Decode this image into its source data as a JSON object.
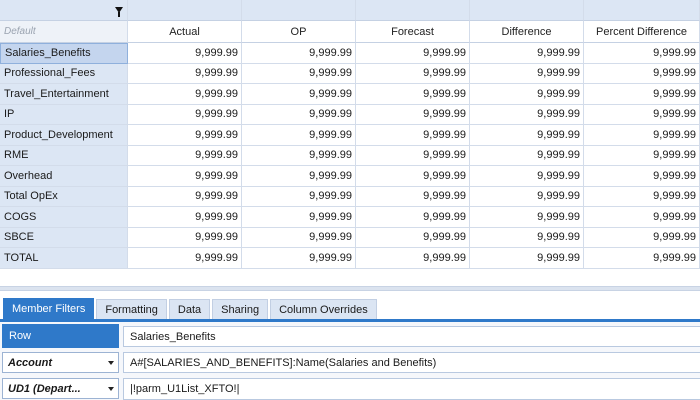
{
  "grid": {
    "default_label": "Default",
    "filter_icon": "filter-icon",
    "columns": [
      "Actual",
      "OP",
      "Forecast",
      "Difference",
      "Percent Difference"
    ],
    "rows": [
      {
        "label": "Salaries_Benefits",
        "values": [
          "9,999.99",
          "9,999.99",
          "9,999.99",
          "9,999.99",
          "9,999.99"
        ]
      },
      {
        "label": "Professional_Fees",
        "values": [
          "9,999.99",
          "9,999.99",
          "9,999.99",
          "9,999.99",
          "9,999.99"
        ]
      },
      {
        "label": "Travel_Entertainment",
        "values": [
          "9,999.99",
          "9,999.99",
          "9,999.99",
          "9,999.99",
          "9,999.99"
        ]
      },
      {
        "label": "IP",
        "values": [
          "9,999.99",
          "9,999.99",
          "9,999.99",
          "9,999.99",
          "9,999.99"
        ]
      },
      {
        "label": "Product_Development",
        "values": [
          "9,999.99",
          "9,999.99",
          "9,999.99",
          "9,999.99",
          "9,999.99"
        ]
      },
      {
        "label": "RME",
        "values": [
          "9,999.99",
          "9,999.99",
          "9,999.99",
          "9,999.99",
          "9,999.99"
        ]
      },
      {
        "label": "Overhead",
        "values": [
          "9,999.99",
          "9,999.99",
          "9,999.99",
          "9,999.99",
          "9,999.99"
        ]
      },
      {
        "label": "Total OpEx",
        "values": [
          "9,999.99",
          "9,999.99",
          "9,999.99",
          "9,999.99",
          "9,999.99"
        ]
      },
      {
        "label": "COGS",
        "values": [
          "9,999.99",
          "9,999.99",
          "9,999.99",
          "9,999.99",
          "9,999.99"
        ]
      },
      {
        "label": "SBCE",
        "values": [
          "9,999.99",
          "9,999.99",
          "9,999.99",
          "9,999.99",
          "9,999.99"
        ]
      },
      {
        "label": "TOTAL",
        "values": [
          "9,999.99",
          "9,999.99",
          "9,999.99",
          "9,999.99",
          "9,999.99"
        ]
      }
    ],
    "selected_row_label": "Salaries_Benefits"
  },
  "tabs": [
    "Member Filters",
    "Formatting",
    "Data",
    "Sharing",
    "Column Overrides"
  ],
  "active_tab": "Member Filters",
  "properties": {
    "row": {
      "label": "Row",
      "value": "Salaries_Benefits"
    },
    "account": {
      "label": "Account",
      "value": "A#[SALARIES_AND_BENEFITS]:Name(Salaries and Benefits)"
    },
    "ud1": {
      "label": "UD1 (Depart...",
      "value": "|!parm_U1List_XFTO!|"
    }
  },
  "colors": {
    "accent": "#2f79c9",
    "header_bg": "#dce6f4",
    "selected_bg": "#c4d5ee",
    "grid_line": "#d3dcea"
  }
}
